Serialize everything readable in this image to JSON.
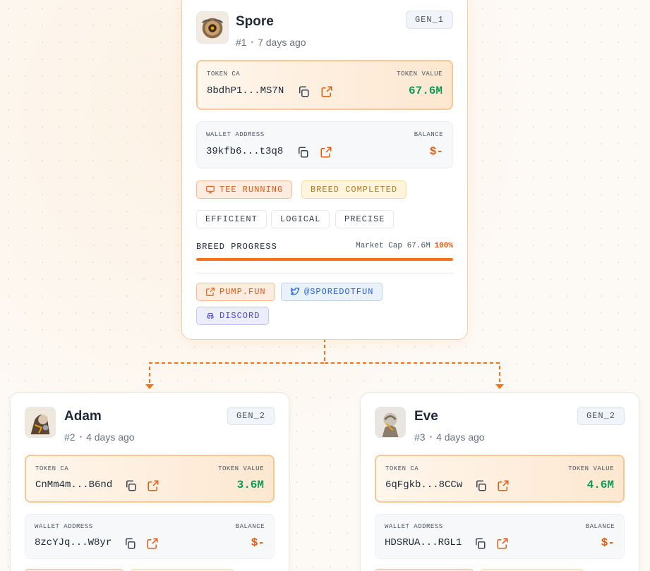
{
  "cards": [
    {
      "name": "Spore",
      "number": "#1",
      "age": "7 days ago",
      "generation": "GEN_1",
      "token_ca_label": "TOKEN CA",
      "token_ca": "8bdhP1...MS7N",
      "token_value_label": "TOKEN VALUE",
      "token_value": "67.6M",
      "wallet_label": "WALLET ADDRESS",
      "wallet": "39kfb6...t3q8",
      "balance_label": "BALANCE",
      "balance": "$-",
      "status_tee": "TEE RUNNING",
      "status_breed": "BREED COMPLETED",
      "traits": [
        "EFFICIENT",
        "LOGICAL",
        "PRECISE"
      ],
      "progress_label": "BREED PROGRESS",
      "market_cap_text": "Market Cap 67.6M",
      "progress_percent_text": "100%",
      "progress_fraction": 1.0,
      "links": {
        "pump": "PUMP.FUN",
        "twitter": "@SPOREDOTFUN",
        "discord": "DISCORD"
      }
    },
    {
      "name": "Adam",
      "number": "#2",
      "age": "4 days ago",
      "generation": "GEN_2",
      "token_ca_label": "TOKEN CA",
      "token_ca": "CnMm4m...B6nd",
      "token_value_label": "TOKEN VALUE",
      "token_value": "3.6M",
      "wallet_label": "WALLET ADDRESS",
      "wallet": "8zcYJq...W8yr",
      "balance_label": "BALANCE",
      "balance": "$-"
    },
    {
      "name": "Eve",
      "number": "#3",
      "age": "4 days ago",
      "generation": "GEN_2",
      "token_ca_label": "TOKEN CA",
      "token_ca": "6qFgkb...8CCw",
      "token_value_label": "TOKEN VALUE",
      "token_value": "4.6M",
      "wallet_label": "WALLET ADDRESS",
      "wallet": "HDSRUA...RGL1",
      "balance_label": "BALANCE",
      "balance": "$-"
    }
  ],
  "colors": {
    "accent": "#f97316",
    "value_green": "#0d9b5a",
    "balance_orange": "#ea580c",
    "twitter_blue": "#2563eb",
    "discord_indigo": "#4f46e5"
  },
  "icons": [
    "copy-icon",
    "external-link-icon",
    "monitor-icon",
    "twitter-icon",
    "discord-icon",
    "arrow-down-icon"
  ]
}
